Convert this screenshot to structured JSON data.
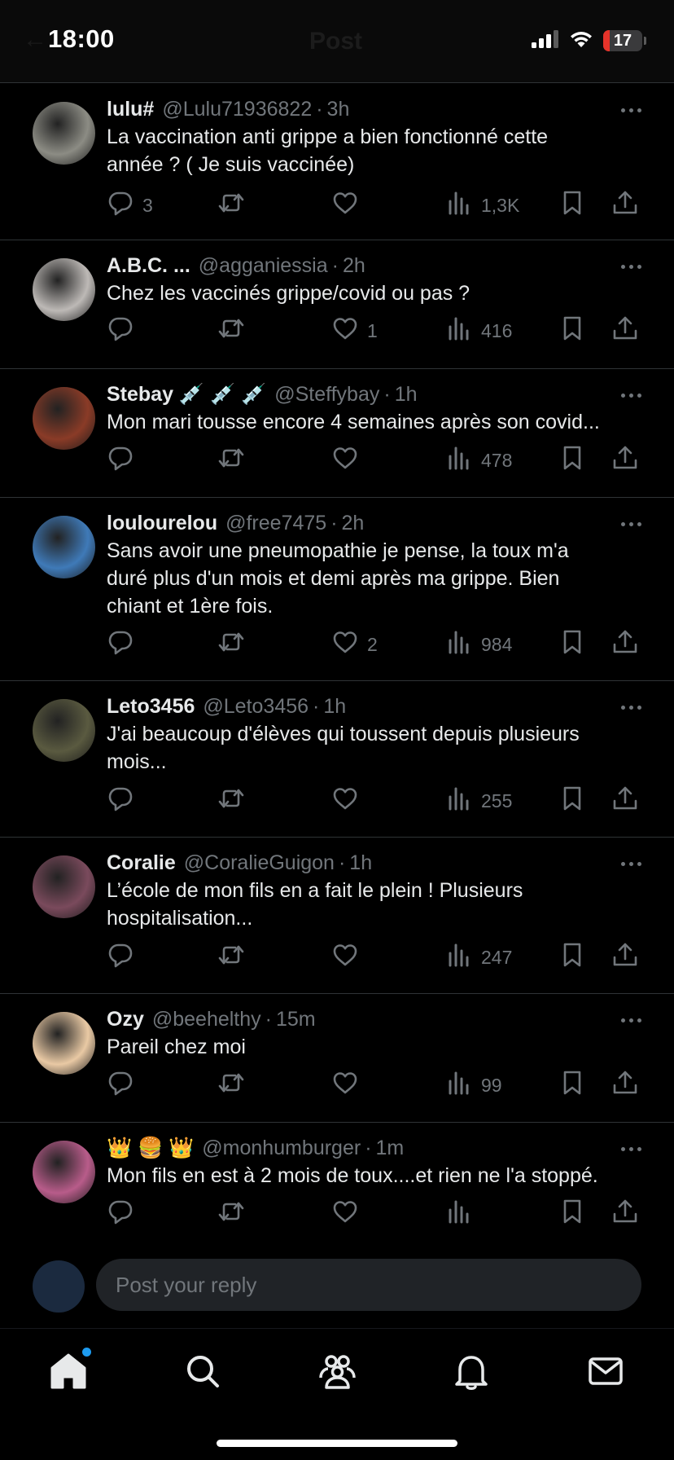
{
  "status_bar": {
    "time": "18:00",
    "battery": "17",
    "battery_level": 0.17,
    "ghost_back": "←",
    "ghost_title": "Post"
  },
  "posts": [
    {
      "name": "lulu#",
      "handle": "@Lulu71936822",
      "age": "3h",
      "avatar_color": "#8c8c84",
      "text": "La vaccination anti grippe a bien fonctionné cette\nannée ? ( Je suis vaccinée)",
      "replies": "3",
      "reposts": "",
      "likes": "",
      "views": "1,3K"
    },
    {
      "name": "A.B.C. ...",
      "handle": "@agganiessia",
      "age": "2h",
      "avatar_color": "#bdb9b6",
      "text": "Chez les vaccinés grippe/covid ou pas ?",
      "replies": "",
      "reposts": "",
      "likes": "1",
      "views": "416"
    },
    {
      "name": "Stebay 💉 💉 💉",
      "handle": "@Steffybay",
      "age": "1h",
      "avatar_color": "#8a3b27",
      "text": "Mon mari tousse encore 4 semaines après son covid...",
      "replies": "",
      "reposts": "",
      "likes": "",
      "views": "478"
    },
    {
      "name": "loulourelou",
      "handle": "@free7475",
      "age": "2h",
      "avatar_color": "#3f7ab8",
      "text": "Sans avoir une pneumopathie je pense, la toux m'a\nduré plus d'un mois et demi après ma grippe. Bien\nchiant et 1ère fois.",
      "replies": "",
      "reposts": "",
      "likes": "2",
      "views": "984"
    },
    {
      "name": "Leto3456",
      "handle": "@Leto3456",
      "age": "1h",
      "avatar_color": "#5a5a40",
      "text": "J'ai beaucoup d'élèves qui toussent depuis plusieurs\nmois...",
      "replies": "",
      "reposts": "",
      "likes": "",
      "views": "255"
    },
    {
      "name": "Coralie",
      "handle": "@CoralieGuigon",
      "age": "1h",
      "avatar_color": "#7a4a5c",
      "text": "L’école de mon fils en a fait le plein ! Plusieurs\nhospitalisation...",
      "replies": "",
      "reposts": "",
      "likes": "",
      "views": "247"
    },
    {
      "name": "Ozy",
      "handle": "@beehelthy",
      "age": "15m",
      "avatar_color": "#e9c9a4",
      "text": "Pareil chez moi",
      "replies": "",
      "reposts": "",
      "likes": "",
      "views": "99"
    },
    {
      "name": "👑 🍔 👑",
      "handle": "@monhumburger",
      "age": "1m",
      "avatar_color": "#b85c8a",
      "text": "Mon fils en est à 2 mois de toux....et rien ne l'a stoppé.",
      "replies": "",
      "reposts": "",
      "likes": "",
      "views": ""
    }
  ],
  "reply": {
    "placeholder": "Post your reply",
    "value": ""
  },
  "tabs": [
    {
      "icon": "home-icon",
      "active": true
    },
    {
      "icon": "search-icon",
      "active": false
    },
    {
      "icon": "communities-icon",
      "active": false
    },
    {
      "icon": "notifications-icon",
      "active": false
    },
    {
      "icon": "messages-icon",
      "active": false
    }
  ],
  "colors": {
    "background": "#000000",
    "text": "#e7e9ea",
    "muted": "#71767b",
    "divider": "#2f3336",
    "accent": "#1d9bf0",
    "battery_low": "#e5332a"
  }
}
